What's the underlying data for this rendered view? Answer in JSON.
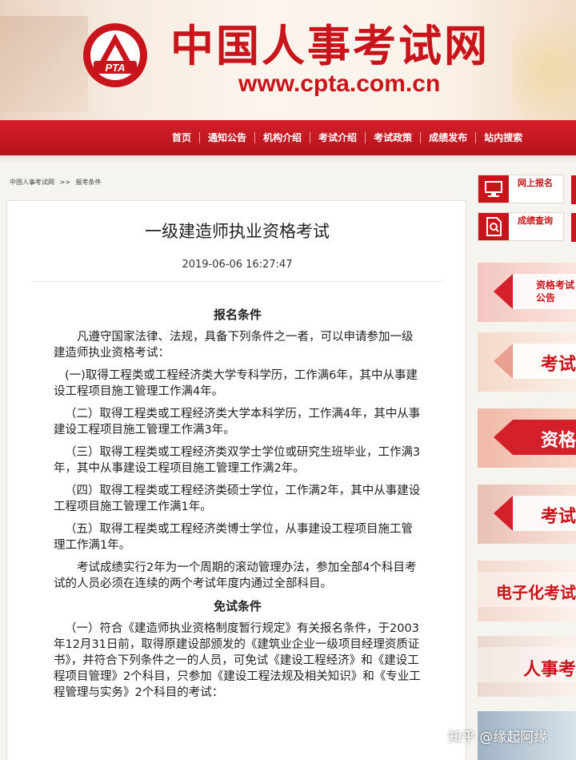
{
  "header": {
    "logo_text": "PTA",
    "site_title": "中国人事考试网",
    "site_url": "www.cpta.com.cn"
  },
  "nav": {
    "items": [
      "首页",
      "通知公告",
      "机构介绍",
      "考试介绍",
      "考试政策",
      "成绩发布",
      "站内搜索"
    ]
  },
  "breadcrumb": {
    "home": "中国人事考试网",
    "sep": ">>",
    "current": "报考条件"
  },
  "article": {
    "title": "一级建造师执业资格考试",
    "date": "2019-06-06 16:27:47",
    "section1_title": "报名条件",
    "intro": "凡遵守国家法律、法规，具备下列条件之一者，可以申请参加一级建造师执业资格考试：",
    "conditions": [
      "(一)取得工程类或工程经济类大学专科学历，工作满6年，其中从事建设工程项目施工管理工作满4年。",
      "（二）取得工程类或工程经济类大学本科学历，工作满4年，其中从事建设工程项目施工管理工作满3年。",
      "（三）取得工程类或工程经济类双学士学位或研究生班毕业，工作满3年，其中从事建设工程项目施工管理工作满2年。",
      "（四）取得工程类或工程经济类硕士学位，工作满2年，其中从事建设工程项目施工管理工作满1年。",
      "（五）取得工程类或工程经济类博士学位，从事建设工程项目施工管理工作满1年。"
    ],
    "rolling_note": "考试成绩实行2年为一个周期的滚动管理办法，参加全部4个科目考试的人员必须在连续的两个考试年度内通过全部科目。",
    "section2_title": "免试条件",
    "exempt_para": "（一）符合《建造师执业资格制度暂行规定》有关报名条件，于2003年12月31日前，取得原建设部颁发的《建筑业企业一级项目经理资质证书》，并符合下列条件之一的人员，可免试《建设工程经济》和《建设工程项目管理》2个科目，只参加《建设工程法规及相关知识》和《专业工程管理与实务》2个科目的考试："
  },
  "sidebar": {
    "btn_register": "网上报名",
    "btn_score": "成绩查询",
    "banners": [
      "资格考试公告",
      "考试",
      "资格",
      "考试",
      "电子化考试",
      "人事考"
    ]
  },
  "watermark": "知乎 @缘起阿缘"
}
